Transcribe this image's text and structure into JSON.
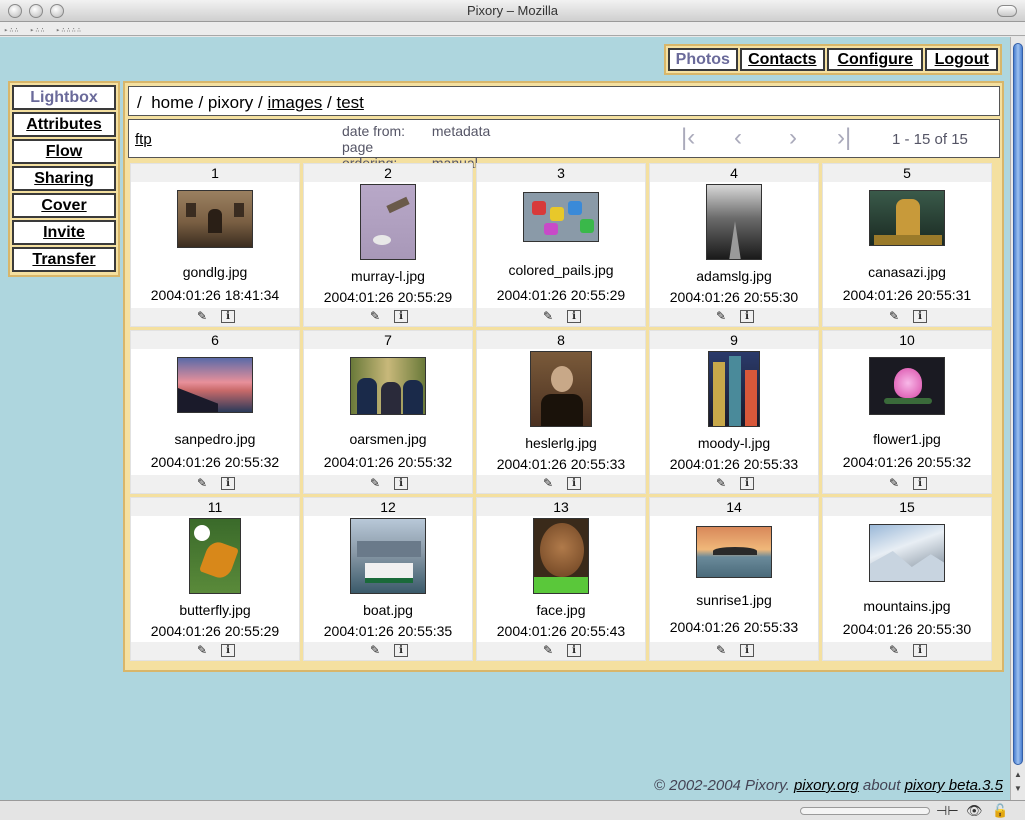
{
  "window": {
    "title": "Pixory – Mozilla"
  },
  "top_nav": [
    {
      "label": "Photos",
      "active": true
    },
    {
      "label": "Contacts",
      "active": false
    },
    {
      "label": "Configure",
      "active": false
    },
    {
      "label": "Logout",
      "active": false
    }
  ],
  "left_nav": [
    {
      "label": "Lightbox",
      "active": true
    },
    {
      "label": "Attributes",
      "active": false
    },
    {
      "label": "Flow",
      "active": false
    },
    {
      "label": "Sharing",
      "active": false
    },
    {
      "label": "Cover",
      "active": false
    },
    {
      "label": "Invite",
      "active": false
    },
    {
      "label": "Transfer",
      "active": false
    }
  ],
  "breadcrumb": {
    "root": "/",
    "home": "home",
    "sep": "/",
    "pixory": "pixory",
    "images": "images",
    "test": "test"
  },
  "infobar": {
    "ftp": "ftp",
    "date_from_label": "date from:",
    "date_from_value": "metadata",
    "page_order_label": "page ordering:",
    "page_order_value": "manual",
    "page_count": "1 - 15 of 15"
  },
  "photos": [
    {
      "n": "1",
      "file": "gondlg.jpg",
      "date": "2004:01:26 18:41:34"
    },
    {
      "n": "2",
      "file": "murray-l.jpg",
      "date": "2004:01:26 20:55:29"
    },
    {
      "n": "3",
      "file": "colored_pails.jpg",
      "date": "2004:01:26 20:55:29"
    },
    {
      "n": "4",
      "file": "adamslg.jpg",
      "date": "2004:01:26 20:55:30"
    },
    {
      "n": "5",
      "file": "canasazi.jpg",
      "date": "2004:01:26 20:55:31"
    },
    {
      "n": "6",
      "file": "sanpedro.jpg",
      "date": "2004:01:26 20:55:32"
    },
    {
      "n": "7",
      "file": "oarsmen.jpg",
      "date": "2004:01:26 20:55:32"
    },
    {
      "n": "8",
      "file": "heslerlg.jpg",
      "date": "2004:01:26 20:55:33"
    },
    {
      "n": "9",
      "file": "moody-l.jpg",
      "date": "2004:01:26 20:55:33"
    },
    {
      "n": "10",
      "file": "flower1.jpg",
      "date": "2004:01:26 20:55:32"
    },
    {
      "n": "11",
      "file": "butterfly.jpg",
      "date": "2004:01:26 20:55:29"
    },
    {
      "n": "12",
      "file": "boat.jpg",
      "date": "2004:01:26 20:55:35"
    },
    {
      "n": "13",
      "file": "face.jpg",
      "date": "2004:01:26 20:55:43"
    },
    {
      "n": "14",
      "file": "sunrise1.jpg",
      "date": "2004:01:26 20:55:33"
    },
    {
      "n": "15",
      "file": "mountains.jpg",
      "date": "2004:01:26 20:55:30"
    }
  ],
  "footer": {
    "copyright": "© 2002-2004 Pixory.",
    "site": "pixory.org",
    "about": "about",
    "version": "pixory beta.3.5"
  },
  "colors": {
    "background": "#aed6de",
    "panel": "#f4e0a0",
    "panel_border": "#d8b66a",
    "active_tab": "#6a6a9a"
  }
}
